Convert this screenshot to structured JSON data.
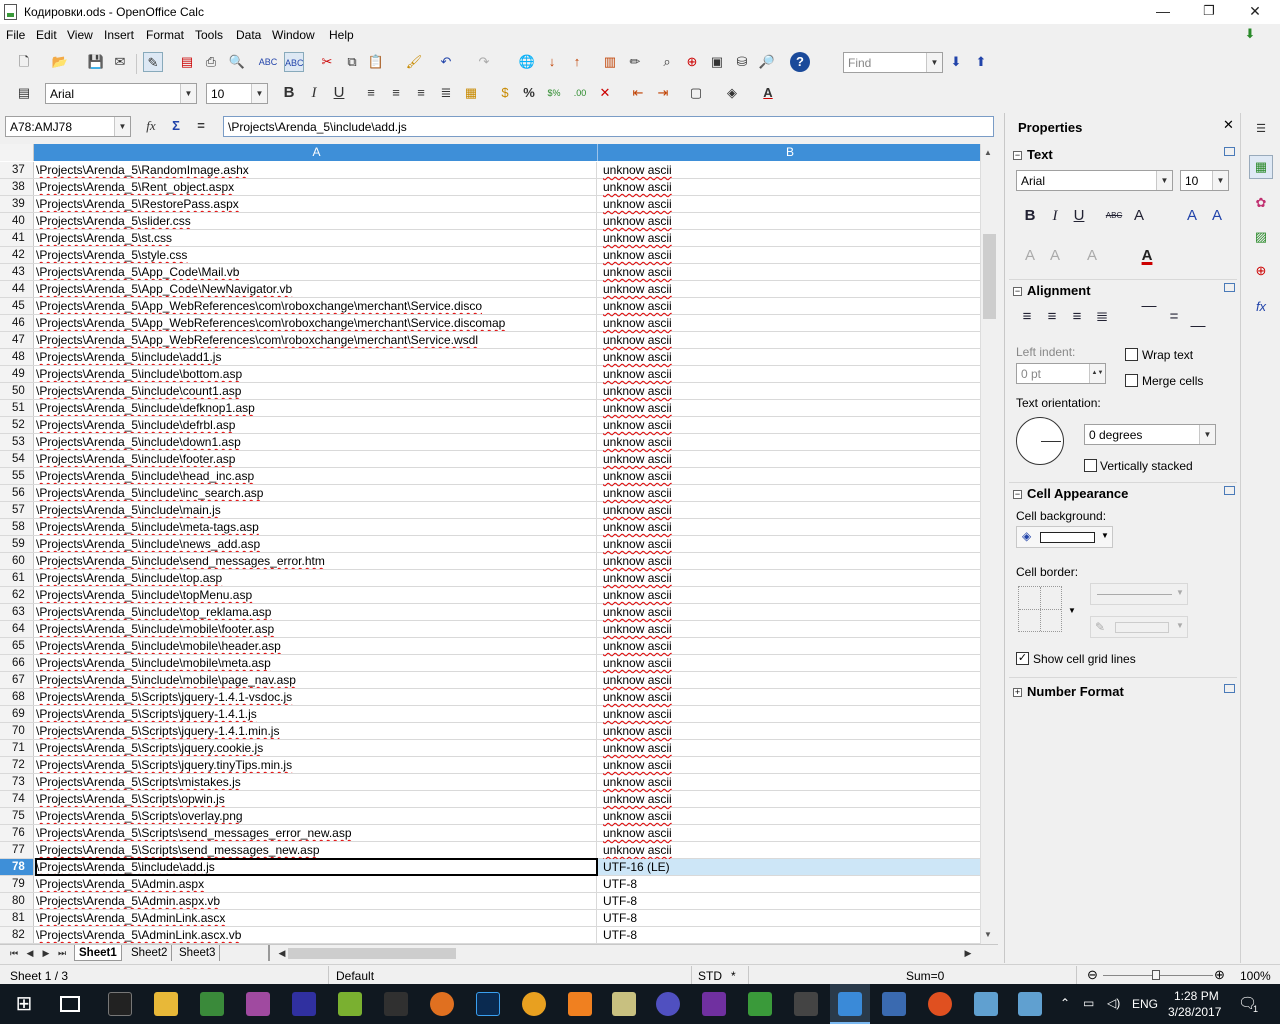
{
  "window": {
    "title": "Кодировки.ods - OpenOffice Calc",
    "min": "—",
    "max": "❐",
    "close": "✕"
  },
  "menu": [
    "File",
    "Edit",
    "View",
    "Insert",
    "Format",
    "Tools",
    "Data",
    "Window",
    "Help"
  ],
  "toolbar": {
    "find_placeholder": "Find"
  },
  "format": {
    "font": "Arial",
    "size": "10"
  },
  "formula": {
    "namebox": "A78:AMJ78",
    "content": "\\Projects\\Arenda_5\\include\\add.js"
  },
  "columns": {
    "a": "A",
    "b": "B"
  },
  "rows": [
    {
      "n": "37",
      "a": "\\Projects\\Arenda_5\\RandomImage.ashx",
      "b": "unknow ascii"
    },
    {
      "n": "38",
      "a": "\\Projects\\Arenda_5\\Rent_object.aspx",
      "b": "unknow ascii"
    },
    {
      "n": "39",
      "a": "\\Projects\\Arenda_5\\RestorePass.aspx",
      "b": "unknow ascii"
    },
    {
      "n": "40",
      "a": "\\Projects\\Arenda_5\\slider.css",
      "b": "unknow ascii"
    },
    {
      "n": "41",
      "a": "\\Projects\\Arenda_5\\st.css",
      "b": "unknow ascii"
    },
    {
      "n": "42",
      "a": "\\Projects\\Arenda_5\\style.css",
      "b": "unknow ascii"
    },
    {
      "n": "43",
      "a": "\\Projects\\Arenda_5\\App_Code\\Mail.vb",
      "b": "unknow ascii"
    },
    {
      "n": "44",
      "a": "\\Projects\\Arenda_5\\App_Code\\NewNavigator.vb",
      "b": "unknow ascii"
    },
    {
      "n": "45",
      "a": "\\Projects\\Arenda_5\\App_WebReferences\\com\\roboxchange\\merchant\\Service.disco",
      "b": "unknow ascii"
    },
    {
      "n": "46",
      "a": "\\Projects\\Arenda_5\\App_WebReferences\\com\\roboxchange\\merchant\\Service.discomap",
      "b": "unknow ascii"
    },
    {
      "n": "47",
      "a": "\\Projects\\Arenda_5\\App_WebReferences\\com\\roboxchange\\merchant\\Service.wsdl",
      "b": "unknow ascii"
    },
    {
      "n": "48",
      "a": "\\Projects\\Arenda_5\\include\\add1.js",
      "b": "unknow ascii"
    },
    {
      "n": "49",
      "a": "\\Projects\\Arenda_5\\include\\bottom.asp",
      "b": "unknow ascii"
    },
    {
      "n": "50",
      "a": "\\Projects\\Arenda_5\\include\\count1.asp",
      "b": "unknow ascii"
    },
    {
      "n": "51",
      "a": "\\Projects\\Arenda_5\\include\\defknop1.asp",
      "b": "unknow ascii"
    },
    {
      "n": "52",
      "a": "\\Projects\\Arenda_5\\include\\defrbl.asp",
      "b": "unknow ascii"
    },
    {
      "n": "53",
      "a": "\\Projects\\Arenda_5\\include\\down1.asp",
      "b": "unknow ascii"
    },
    {
      "n": "54",
      "a": "\\Projects\\Arenda_5\\include\\footer.asp",
      "b": "unknow ascii"
    },
    {
      "n": "55",
      "a": "\\Projects\\Arenda_5\\include\\head_inc.asp",
      "b": "unknow ascii"
    },
    {
      "n": "56",
      "a": "\\Projects\\Arenda_5\\include\\inc_search.asp",
      "b": "unknow ascii"
    },
    {
      "n": "57",
      "a": "\\Projects\\Arenda_5\\include\\main.js",
      "b": "unknow ascii"
    },
    {
      "n": "58",
      "a": "\\Projects\\Arenda_5\\include\\meta-tags.asp",
      "b": "unknow ascii"
    },
    {
      "n": "59",
      "a": "\\Projects\\Arenda_5\\include\\news_add.asp",
      "b": "unknow ascii"
    },
    {
      "n": "60",
      "a": "\\Projects\\Arenda_5\\include\\send_messages_error.htm",
      "b": "unknow ascii"
    },
    {
      "n": "61",
      "a": "\\Projects\\Arenda_5\\include\\top.asp",
      "b": "unknow ascii"
    },
    {
      "n": "62",
      "a": "\\Projects\\Arenda_5\\include\\topMenu.asp",
      "b": "unknow ascii"
    },
    {
      "n": "63",
      "a": "\\Projects\\Arenda_5\\include\\top_reklama.asp",
      "b": "unknow ascii"
    },
    {
      "n": "64",
      "a": "\\Projects\\Arenda_5\\include\\mobile\\footer.asp",
      "b": "unknow ascii"
    },
    {
      "n": "65",
      "a": "\\Projects\\Arenda_5\\include\\mobile\\header.asp",
      "b": "unknow ascii"
    },
    {
      "n": "66",
      "a": "\\Projects\\Arenda_5\\include\\mobile\\meta.asp",
      "b": "unknow ascii"
    },
    {
      "n": "67",
      "a": "\\Projects\\Arenda_5\\include\\mobile\\page_nav.asp",
      "b": "unknow ascii"
    },
    {
      "n": "68",
      "a": "\\Projects\\Arenda_5\\Scripts\\jquery-1.4.1-vsdoc.js",
      "b": "unknow ascii"
    },
    {
      "n": "69",
      "a": "\\Projects\\Arenda_5\\Scripts\\jquery-1.4.1.js",
      "b": "unknow ascii"
    },
    {
      "n": "70",
      "a": "\\Projects\\Arenda_5\\Scripts\\jquery-1.4.1.min.js",
      "b": "unknow ascii"
    },
    {
      "n": "71",
      "a": "\\Projects\\Arenda_5\\Scripts\\jquery.cookie.js",
      "b": "unknow ascii"
    },
    {
      "n": "72",
      "a": "\\Projects\\Arenda_5\\Scripts\\jquery.tinyTips.min.js",
      "b": "unknow ascii"
    },
    {
      "n": "73",
      "a": "\\Projects\\Arenda_5\\Scripts\\mistakes.js",
      "b": "unknow ascii"
    },
    {
      "n": "74",
      "a": "\\Projects\\Arenda_5\\Scripts\\opwin.js",
      "b": "unknow ascii"
    },
    {
      "n": "75",
      "a": "\\Projects\\Arenda_5\\Scripts\\overlay.png",
      "b": "unknow ascii"
    },
    {
      "n": "76",
      "a": "\\Projects\\Arenda_5\\Scripts\\send_messages_error_new.asp",
      "b": "unknow ascii"
    },
    {
      "n": "77",
      "a": "\\Projects\\Arenda_5\\Scripts\\send_messages_new.asp",
      "b": "unknow ascii"
    },
    {
      "n": "78",
      "a": "\\Projects\\Arenda_5\\include\\add.js",
      "b": "UTF-16 (LE)",
      "selected": true
    },
    {
      "n": "79",
      "a": "\\Projects\\Arenda_5\\Admin.aspx",
      "b": "UTF-8"
    },
    {
      "n": "80",
      "a": "\\Projects\\Arenda_5\\Admin.aspx.vb",
      "b": "UTF-8"
    },
    {
      "n": "81",
      "a": "\\Projects\\Arenda_5\\AdminLink.ascx",
      "b": "UTF-8"
    },
    {
      "n": "82",
      "a": "\\Projects\\Arenda_5\\AdminLink.ascx.vb",
      "b": "UTF-8"
    }
  ],
  "sheets": [
    "Sheet1",
    "Sheet2",
    "Sheet3"
  ],
  "status": {
    "sheet": "Sheet 1 / 3",
    "style": "Default",
    "mode": "STD",
    "modified": "*",
    "sum": "Sum=0",
    "zoom": "100%"
  },
  "sidebar": {
    "title": "Properties",
    "text": {
      "heading": "Text",
      "font": "Arial",
      "size": "10"
    },
    "alignment": {
      "heading": "Alignment",
      "left_indent_label": "Left indent:",
      "left_indent_value": "0 pt",
      "wrap_text": "Wrap text",
      "merge_cells": "Merge cells",
      "orientation_label": "Text orientation:",
      "degrees": "0 degrees",
      "vertically_stacked": "Vertically stacked"
    },
    "cell_appearance": {
      "heading": "Cell Appearance",
      "background_label": "Cell background:",
      "border_label": "Cell border:",
      "grid_lines": "Show cell grid lines"
    },
    "number_format": {
      "heading": "Number Format"
    }
  },
  "taskbar": {
    "lang": "ENG",
    "time": "1:28 PM",
    "date": "3/28/2017",
    "notif": "1"
  }
}
